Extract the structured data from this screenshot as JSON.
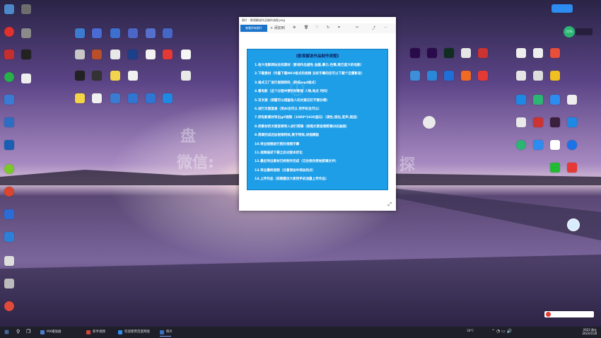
{
  "desktop": {
    "watermark_lines": [
      "盘",
      "微信:"
    ],
    "watermark_right": "探"
  },
  "viewer": {
    "title": "照片 - 影视解说作品制作流程.png",
    "tab_label": "查看所有照片",
    "add_label": "+ 添加到",
    "document": {
      "title": "《影视解说作品制作流程》",
      "steps": [
        "1.各大电影网站去找素材（影视作品避免 血腥,暴力,色情,尾巴度大的电影）",
        "2.下载素材（尽量下载NKV格式的视频 没有字幕的话可以下载个迅雷影音）",
        "3.格式工厂进行视频转码（转成mp4格式）",
        "4.看电影（这个过程中要列好影视 人物,地点 时间）",
        "5.写文案（把握可以借鉴他人的文案记忆不要抄袭）",
        "6.进行文案复查（用AI也可以 用手机也可以）",
        "7.把电影素材导出gif视频（1080*1920竖向）（调色,锐化,变声,挑选）",
        "8.把素材的文案音频导入进行剪辑（按照文案音频剪辑对应画面）",
        "9.剪辑完成后加视频特效,数字特效,封面模板",
        "10.导出视频进行剪好视频字幕",
        "11.视频描述下载之后对版本优化",
        "12.最后导出素材已经制作完成（记住保存原始剪辑文件）",
        "13.导出最终视频（注意添加中添加的点）",
        "14.上传作品（前期建议大家用手机流量上传作品）"
      ]
    }
  },
  "taskbar": {
    "apps": [
      {
        "label": "MX播放器",
        "color": "#4a7bd0"
      },
      {
        "label": "新手视频",
        "color": "#d0453c"
      },
      {
        "label": "欢迎使用百度网盘",
        "color": "#2d8cf0"
      },
      {
        "label": "照片",
        "color": "#3a6fc4"
      }
    ],
    "weather": "18°C",
    "time": "2023 周五",
    "date": "2023/11/8"
  },
  "tray": {
    "badge": "21%"
  }
}
